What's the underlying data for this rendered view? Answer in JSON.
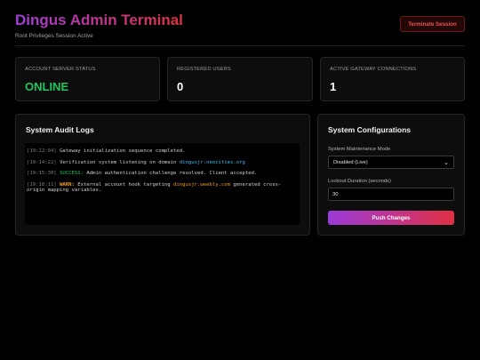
{
  "header": {
    "title": "Dingus Admin Terminal",
    "subtitle": "Root Privileges Session Active",
    "terminate_label": "Terminate Session"
  },
  "stats": [
    {
      "label": "ACCOUNT SERVER STATUS",
      "value": "ONLINE"
    },
    {
      "label": "REGISTERED USERS",
      "value": "0"
    },
    {
      "label": "ACTIVE GATEWAY CONNECTIONS",
      "value": "1"
    }
  ],
  "audit": {
    "title": "System Audit Logs",
    "logs": [
      {
        "ts": "[19:12:04]",
        "text": "Gateway initialization sequence completed."
      },
      {
        "ts": "[19:14:22]",
        "text": "Verification system listening on domain ",
        "link": "dingusjr.neocities.org"
      },
      {
        "ts": "[19:15:30]",
        "tag": "SUCCESS:",
        "text": " Admin authentication challenge resolved. Client accepted."
      },
      {
        "ts": "[19:18:11]",
        "tag": "WARN:",
        "text_before": " External account hook targeting ",
        "link": "dingusjr.weebly.com",
        "text_after": " generated cross-origin mapping variables."
      }
    ]
  },
  "config": {
    "title": "System Configurations",
    "maintenance_label": "System Maintenance Mode",
    "maintenance_value": "Disabled (Live)",
    "lockout_label": "Lockout Duration (seconds)",
    "lockout_value": "30",
    "push_label": "Push Changes"
  },
  "colors": {
    "accent_start": "#a43ddc",
    "accent_end": "#e0323f",
    "online": "#22c55e",
    "danger": "#ef5353",
    "link": "#38bdf8",
    "warn": "#f59e0b"
  }
}
